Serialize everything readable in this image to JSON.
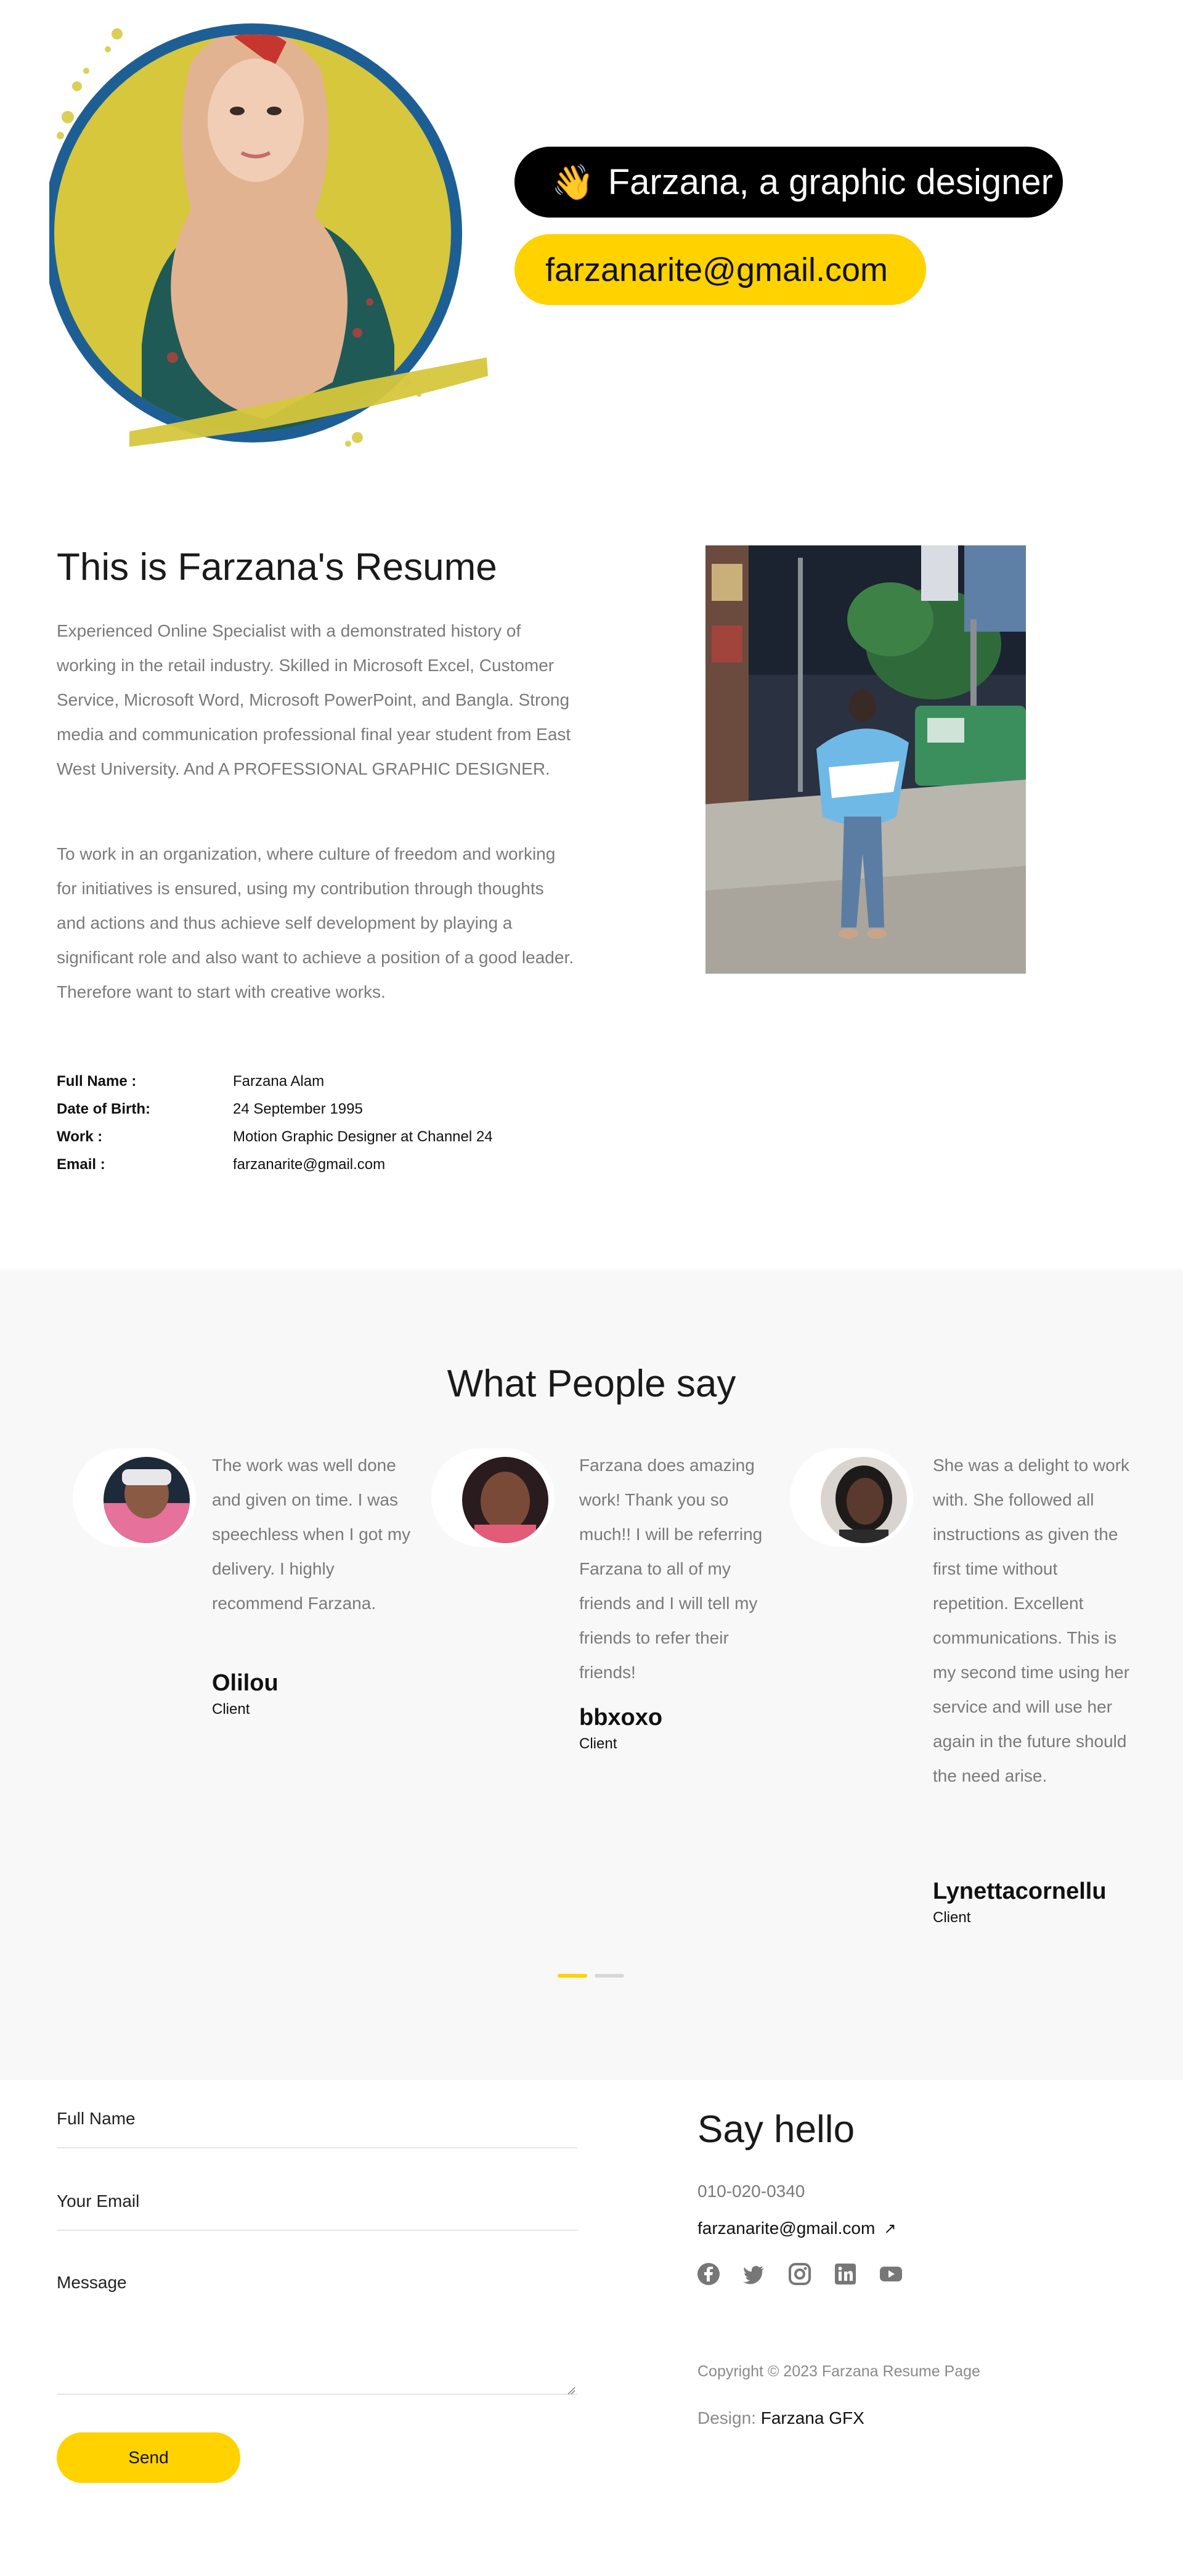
{
  "hero": {
    "wave_emoji": "👋",
    "name_pill": "Farzana, a graphic designer",
    "email_pill": "farzanarite@gmail.com"
  },
  "about": {
    "title": "This is Farzana's Resume",
    "paragraph1": "Experienced Online Specialist with a demonstrated history of working in the retail industry. Skilled in Microsoft Excel, Customer Service, Microsoft Word, Microsoft PowerPoint, and Bangla. Strong media and communication professional final year student from East West University. And A PROFESSIONAL GRAPHIC DESIGNER.",
    "paragraph2": "To work in an organization, where culture of freedom and working for initiatives is ensured, using my contribution through thoughts and actions and thus achieve self development by playing a significant role and also want to achieve a position of a good leader. Therefore want to start with creative works.",
    "info": [
      {
        "label": "Full Name :",
        "value": "Farzana Alam"
      },
      {
        "label": "Date of Birth:",
        "value": "24 September 1995"
      },
      {
        "label": "Work :",
        "value": "Motion Graphic Designer at Channel 24"
      },
      {
        "label": "Email :",
        "value": "farzanarite@gmail.com"
      }
    ]
  },
  "testimonials": {
    "title": "What People say",
    "items": [
      {
        "quote": "The work was well done and given on time. I was speechless when I got my delivery. I highly recommend Farzana.",
        "name": "Olilou",
        "role": "Client"
      },
      {
        "quote": "Farzana does amazing work! Thank you so much!! I will be referring Farzana to all of my friends and I will tell my friends to refer their friends!",
        "name": "bbxoxo",
        "role": "Client"
      },
      {
        "quote": "She was a delight to work with. She followed all instructions as given the first time without repetition. Excellent communications. This is my second time using her service and will use her again in the future should the need arise.",
        "name": "Lynettacornellu",
        "role": "Client"
      }
    ],
    "active_slide": 1,
    "slide_count": 2
  },
  "contact": {
    "full_name_label": "Full Name",
    "email_label": "Your Email",
    "message_label": "Message",
    "send_label": "Send",
    "say_hello": "Say hello",
    "phone": "010-020-0340",
    "email": "farzanarite@gmail.com",
    "arrow": "↗",
    "socials": [
      "facebook-icon",
      "twitter-icon",
      "instagram-icon",
      "linkedin-icon",
      "youtube-icon"
    ],
    "copyright": "Copyright © 2023 Farzana Resume Page",
    "design_prefix": "Design:",
    "design_name": "Farzana GFX"
  },
  "colors": {
    "accent": "#ffd200",
    "dark": "#000000",
    "ring_blue": "#1d5f94",
    "ring_yellow": "#d6c73c",
    "section_gray": "#f8f8f8"
  }
}
